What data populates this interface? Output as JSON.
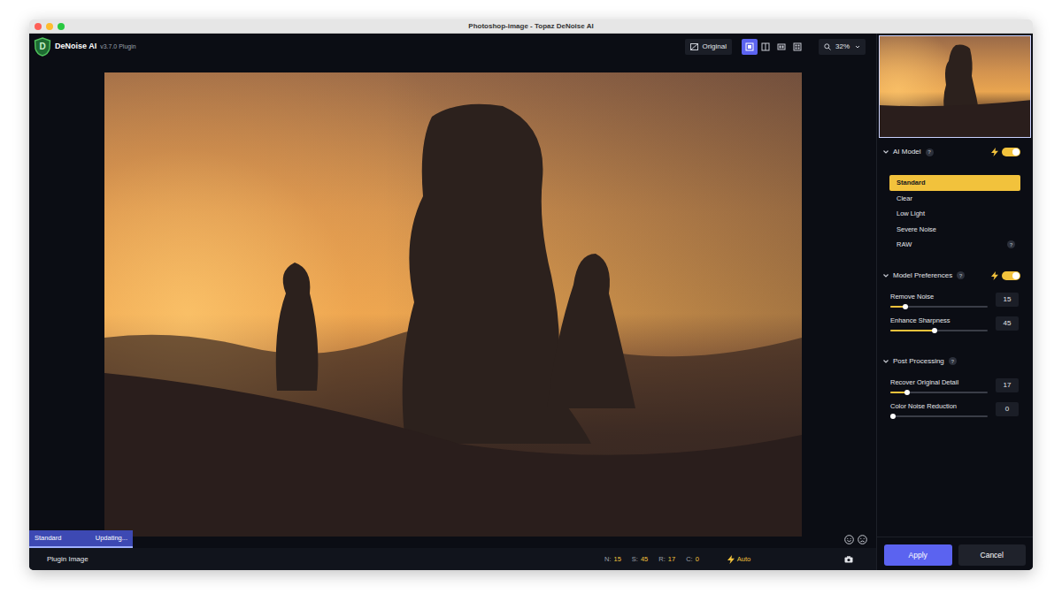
{
  "window": {
    "title": "Photoshop-image - Topaz DeNoise AI"
  },
  "app": {
    "logo": "D",
    "name": "DeNoise AI",
    "version": "v3.7.0 Plugin"
  },
  "toolbar": {
    "original_label": "Original",
    "view_modes": [
      {
        "kind": "single",
        "selected": true
      },
      {
        "kind": "split",
        "selected": false
      },
      {
        "kind": "side",
        "selected": false
      },
      {
        "kind": "quad",
        "selected": false
      }
    ],
    "zoom": "32%"
  },
  "preview": {
    "model": "Standard",
    "status": "Updating..."
  },
  "status_bar": {
    "source": "Plugin Image",
    "readings": [
      {
        "key": "N:",
        "value": "15"
      },
      {
        "key": "S:",
        "value": "45"
      },
      {
        "key": "R:",
        "value": "17"
      },
      {
        "key": "C:",
        "value": "0"
      }
    ],
    "auto": "Auto"
  },
  "ai_model": {
    "title": "AI Model",
    "help": "?",
    "expanded": true,
    "enabled": true,
    "models": [
      {
        "label": "Standard",
        "selected": true,
        "help": ""
      },
      {
        "label": "Clear",
        "selected": false,
        "help": ""
      },
      {
        "label": "Low Light",
        "selected": false,
        "help": ""
      },
      {
        "label": "Severe Noise",
        "selected": false,
        "help": ""
      },
      {
        "label": "RAW",
        "selected": false,
        "help": "?"
      }
    ]
  },
  "model_preferences": {
    "title": "Model Preferences",
    "help": "?",
    "expanded": true,
    "enabled": true,
    "sliders": [
      {
        "label": "Remove Noise",
        "value": "15",
        "level": 0.15
      },
      {
        "label": "Enhance Sharpness",
        "value": "45",
        "level": 0.45
      }
    ]
  },
  "post_processing": {
    "title": "Post Processing",
    "help": "?",
    "expanded": true,
    "sliders": [
      {
        "label": "Recover Original Detail",
        "value": "17",
        "level": 0.17
      },
      {
        "label": "Color Noise Reduction",
        "value": "0",
        "level": 0
      }
    ]
  },
  "buttons": [
    {
      "label": "Apply",
      "kind": "primary"
    },
    {
      "label": "Cancel",
      "kind": "secondary"
    }
  ]
}
